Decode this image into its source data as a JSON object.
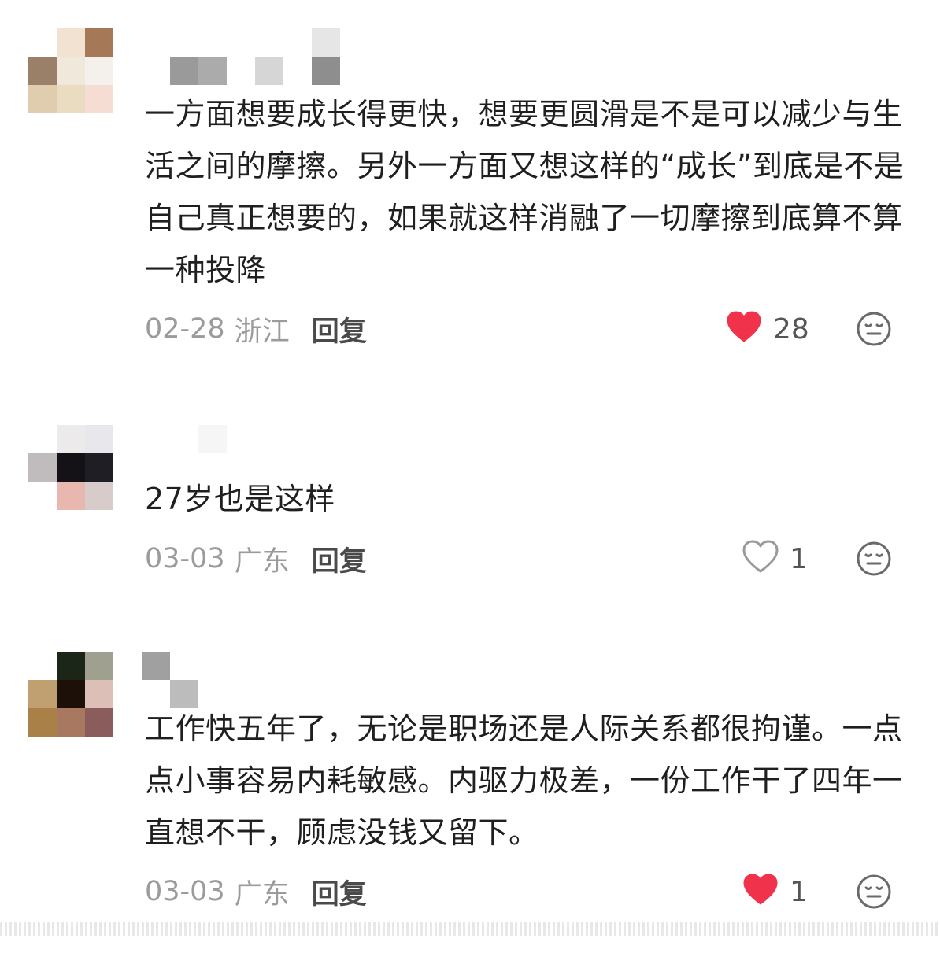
{
  "comments": [
    {
      "text": "一方面想要成长得更快，想要更圆滑是不是可以减少与生活之间的摩擦。另外一方面又想这样的“成长”到底是不是自己真正想要的，如果就这样消融了一切摩擦到底算不算一种投降",
      "date": "02-28",
      "region": "浙江",
      "reply_label": "回复",
      "like_count": "28",
      "liked": true,
      "avatar_colors": [
        "#ffffff",
        "#f2e2d2",
        "#a57858",
        "#9a8068",
        "#f1e8dc",
        "#f4f0ec",
        "#e0cdb0",
        "#eadcc0",
        "#f6ddd4"
      ]
    },
    {
      "text": "27岁也是这样",
      "date": "03-03",
      "region": "广东",
      "reply_label": "回复",
      "like_count": "1",
      "liked": false,
      "avatar_colors": [
        "#ffffff",
        "#eceaea",
        "#e8e8ec",
        "#c0bcbe",
        "#141216",
        "#1e1e24",
        "#ffffff",
        "#e8b8b0",
        "#d8ccca"
      ]
    },
    {
      "text": "工作快五年了，无论是职场还是人际关系都很拘谨。一点点小事容易内耗敏感。内驱力极差，一份工作干了四年一直想不干，顾虑没钱又留下。",
      "date": "03-03",
      "region": "广东",
      "reply_label": "回复",
      "like_count": "1",
      "liked": true,
      "avatar_colors": [
        "#ffffff",
        "#1c2618",
        "#a0a090",
        "#c0a070",
        "#1c1008",
        "#dcc0b8",
        "#a88048",
        "#a87860",
        "#8a5c5c"
      ]
    }
  ],
  "colors": {
    "heart_liked": "#f0324a",
    "heart_outline": "#9a9a9a",
    "text_primary": "#1f1f1f",
    "text_meta": "#9b9b9b"
  },
  "icons": {
    "like": "heart-icon",
    "dislike": "neutral-face-icon"
  }
}
